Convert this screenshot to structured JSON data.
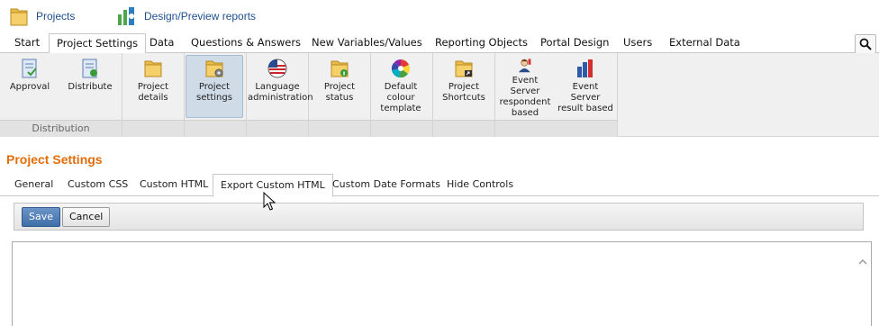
{
  "toplinks": {
    "projects": "Projects",
    "design_preview": "Design/Preview reports"
  },
  "ribbon_tabs": [
    {
      "label": "Start"
    },
    {
      "label": "Project Settings"
    },
    {
      "label": "Data"
    },
    {
      "label": "Questions & Answers"
    },
    {
      "label": "New Variables/Values"
    },
    {
      "label": "Reporting Objects"
    },
    {
      "label": "Portal Design"
    },
    {
      "label": "Users"
    },
    {
      "label": "External Data"
    }
  ],
  "active_ribbon_tab": "Project Settings",
  "ribbon": {
    "group_label": "Distribution",
    "buttons": [
      {
        "label": "Approval",
        "icon": "approval-doc-icon"
      },
      {
        "label": "Distribute",
        "icon": "distribute-doc-icon"
      },
      {
        "label": "Project details",
        "icon": "folder-icon"
      },
      {
        "label": "Project settings",
        "icon": "folder-gear-icon"
      },
      {
        "label": "Language administration",
        "icon": "us-flag-globe-icon"
      },
      {
        "label": "Project status",
        "icon": "folder-info-icon"
      },
      {
        "label": "Default colour template",
        "icon": "colour-wheel-icon"
      },
      {
        "label": "Project Shortcuts",
        "icon": "folder-shortcut-icon"
      },
      {
        "label": "Event Server respondent based",
        "icon": "respondent-person-icon"
      },
      {
        "label": "Event Server result based",
        "icon": "bar-chart-icon"
      }
    ]
  },
  "page": {
    "title": "Project Settings"
  },
  "sub_tabs": [
    {
      "label": "General"
    },
    {
      "label": "Custom CSS"
    },
    {
      "label": "Custom HTML"
    },
    {
      "label": "Export Custom HTML"
    },
    {
      "label": "Custom Date Formats"
    },
    {
      "label": "Hide Controls"
    }
  ],
  "active_sub_tab": "Export Custom HTML",
  "toolbar": {
    "save_label": "Save",
    "cancel_label": "Cancel"
  },
  "editor": {
    "value": ""
  },
  "colors": {
    "title_orange": "#e46c0a",
    "link_blue": "#1f4f8f",
    "primary_button": "#3f6ea8"
  }
}
